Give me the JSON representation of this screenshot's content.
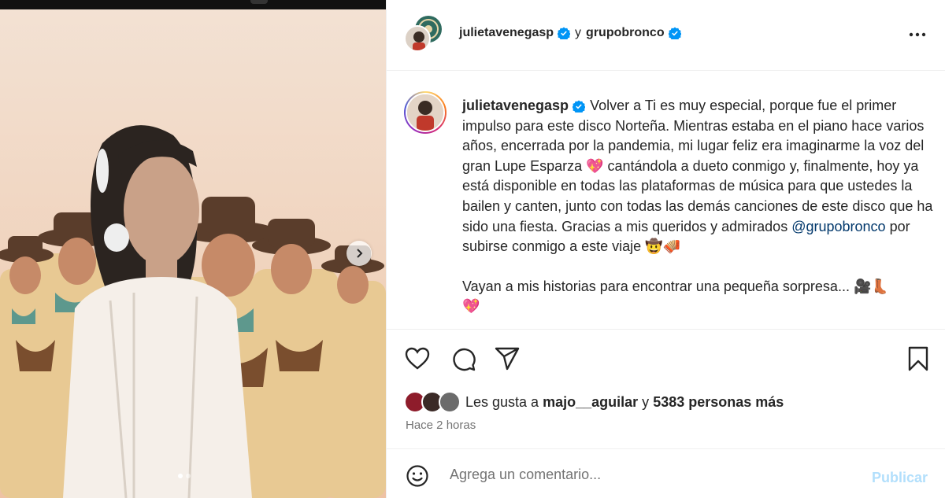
{
  "post": {
    "header": {
      "user1": "julietavenegasp",
      "separator": "y",
      "user2": "grupobronco",
      "more_icon": "more-horizontal-icon"
    },
    "caption": {
      "username": "julietavenegasp",
      "text_part1": "Volver a Ti es muy especial, porque fue el primer impulso para este disco Norteña. Mientras estaba en el piano hace varios años, encerrada por la pandemia, mi lugar feliz era imaginarme la voz del gran Lupe Esparza 💖 cantándola a dueto conmigo y, finalmente, hoy ya está disponible en todas las plataformas de música para que ustedes la bailen y canten, junto con todas las demás canciones de este disco que ha sido una fiesta. Gracias a mis queridos y admirados ",
      "mention": "@grupobronco",
      "text_part2": " por subirse conmigo a este viaje 🤠🪗",
      "paragraph2": "Vayan a mis historias para encontrar una pequeña sorpresa... 🎥👢\n💖"
    },
    "likes": {
      "prefix": "Les gusta a",
      "user": "majo__aguilar",
      "connector": "y",
      "others": "5383 personas más"
    },
    "time_ago": "Hace 2 horas",
    "comment": {
      "placeholder": "Agrega un comentario...",
      "publish_label": "Publicar"
    },
    "colors": {
      "verified": "#0095f6",
      "mention": "#00376b",
      "publish_disabled": "#b2dffc"
    }
  }
}
